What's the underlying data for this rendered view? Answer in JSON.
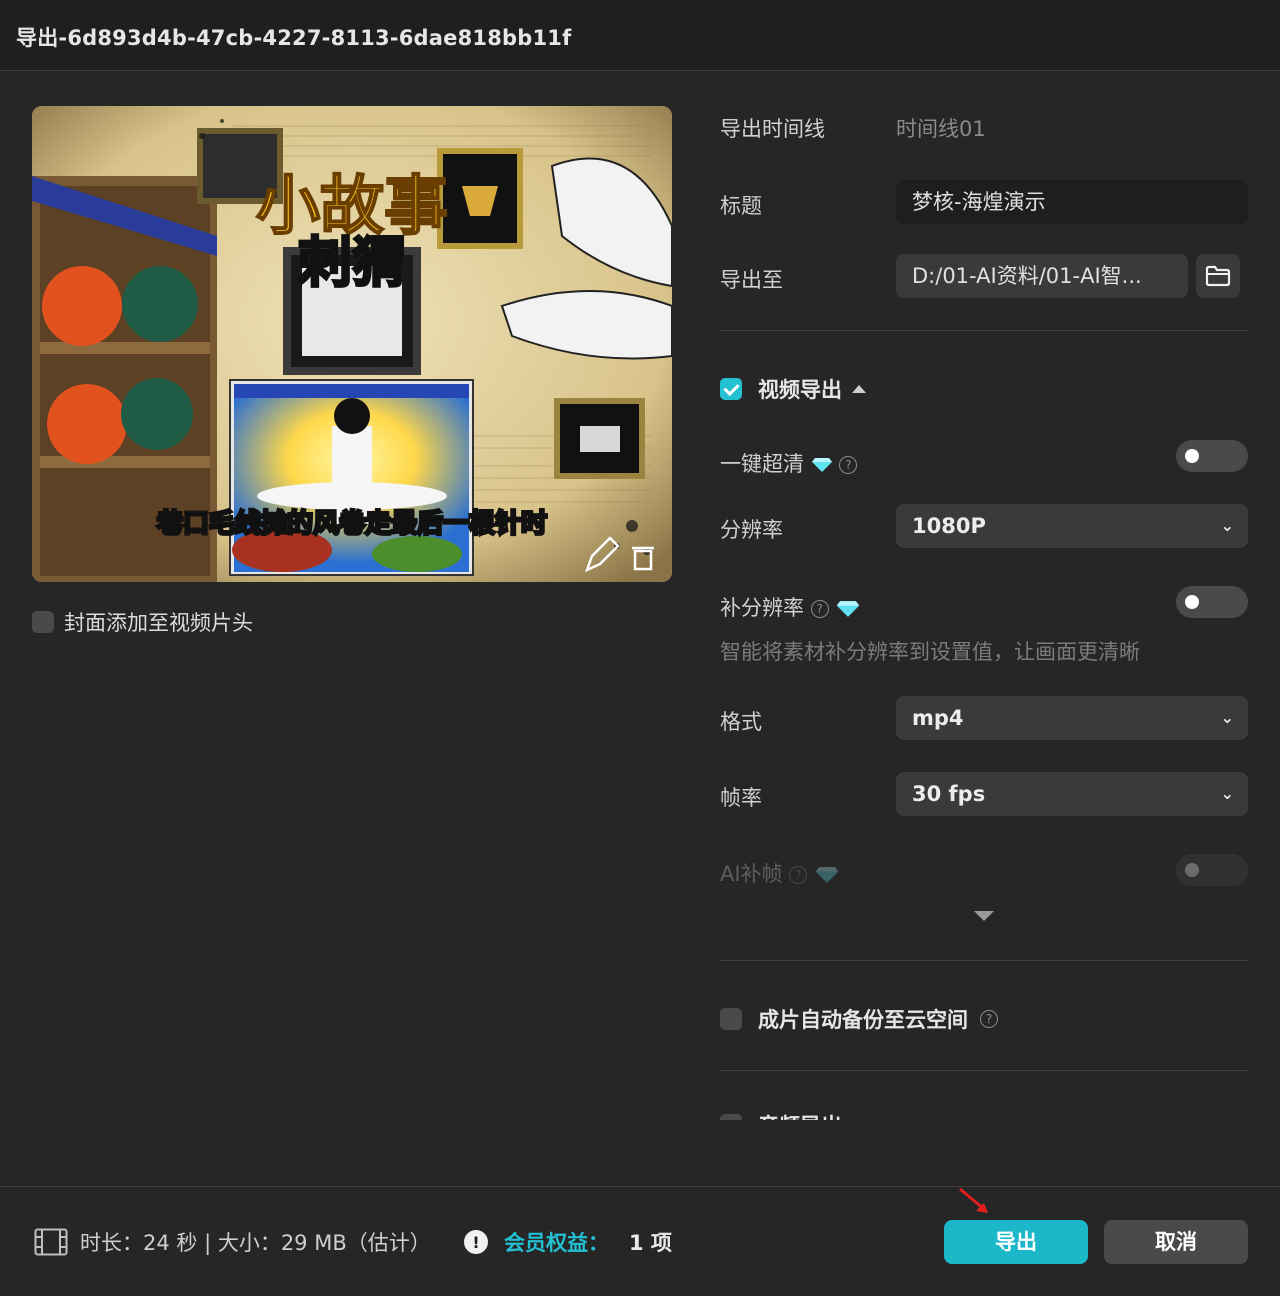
{
  "window": {
    "title": "导出-6d893d4b-47cb-4227-8113-6dae818bb11f"
  },
  "preview": {
    "overlay_title_big": "小故事",
    "overlay_title_sub": "刺猬",
    "caption": "巷口毛线摊的风卷走最后一根针时",
    "edit_icon": "pencil-icon",
    "delete_icon": "trash-icon"
  },
  "cover": {
    "label": "封面添加至视频片头",
    "checked": false
  },
  "settings": {
    "timeline": {
      "label": "导出时间线",
      "value": "时间线01"
    },
    "title": {
      "label": "标题",
      "value": "梦核-海煌演示"
    },
    "export_to": {
      "label": "导出至",
      "value": "D:/01-AI资料/01-AI智...",
      "icon": "folder-icon"
    },
    "video_export": {
      "label": "视频导出",
      "checked": true
    },
    "one_click_hd": {
      "label": "一键超清",
      "enabled": false
    },
    "resolution": {
      "label": "分辨率",
      "value": "1080P"
    },
    "upscale": {
      "label": "补分辨率",
      "enabled": false,
      "hint": "智能将素材补分辨率到设置值，让画面更清晰"
    },
    "format": {
      "label": "格式",
      "value": "mp4"
    },
    "framerate": {
      "label": "帧率",
      "value": "30 fps"
    },
    "ai_frame": {
      "label": "AI补帧",
      "enabled": false
    },
    "cloud_backup": {
      "label": "成片自动备份至云空间",
      "checked": false
    },
    "audio_export": {
      "label": "音频导出"
    }
  },
  "footer": {
    "info": "时长：24 秒 | 大小：29 MB（估计）",
    "member_label": "会员权益：",
    "member_count": "1 项",
    "export_button": "导出",
    "cancel_button": "取消"
  },
  "colors": {
    "accent": "#1cb8c9",
    "background": "#262626",
    "field": "#3a3a3a"
  }
}
